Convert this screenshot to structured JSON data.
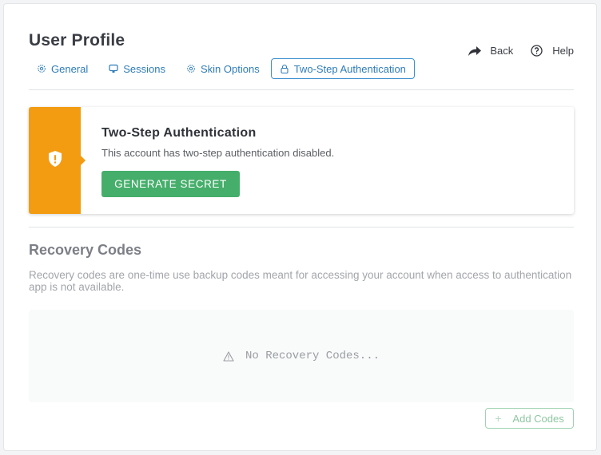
{
  "page": {
    "title": "User Profile"
  },
  "tabs": [
    {
      "label": "General",
      "icon": "gear-icon",
      "active": false
    },
    {
      "label": "Sessions",
      "icon": "monitor-icon",
      "active": false
    },
    {
      "label": "Skin Options",
      "icon": "gear-icon",
      "active": false
    },
    {
      "label": "Two-Step Authentication",
      "icon": "lock-icon",
      "active": true
    }
  ],
  "actions": {
    "back_label": "Back",
    "help_label": "Help"
  },
  "alert": {
    "title": "Two-Step Authentication",
    "message": "This account has two-step authentication disabled.",
    "button_label": "GENERATE SECRET",
    "icon": "shield-alert-icon",
    "accent_color": "#f39c12",
    "button_color": "#46ae6b"
  },
  "recovery": {
    "title": "Recovery Codes",
    "description": "Recovery codes are one-time use backup codes meant for accessing your account when access to authentication app is not available.",
    "empty_text": "No Recovery Codes...",
    "add_button_label": "Add Codes"
  }
}
